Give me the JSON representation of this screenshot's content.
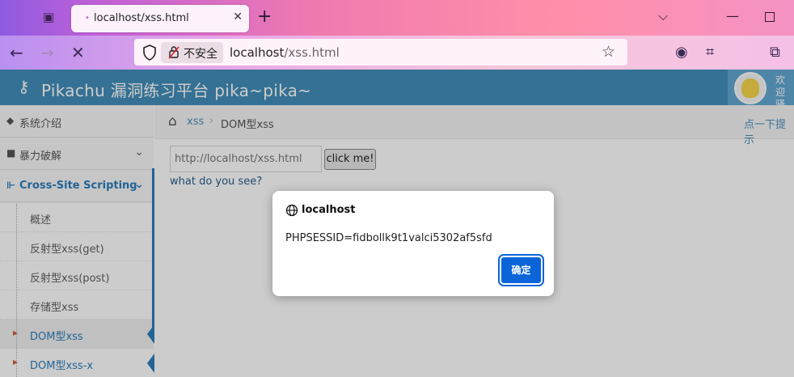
{
  "browser": {
    "tab_title": "localhost/xss.html",
    "tab_close": "✕",
    "new_tab": "+",
    "insecure_label": "不安全",
    "url_host": "localhost",
    "url_path": "/xss.html"
  },
  "header": {
    "site_title": "Pikachu 漏洞练习平台 pika~pika~",
    "user_line1": "欢迎",
    "user_line2": "骚年"
  },
  "sidebar": {
    "items": [
      {
        "label": "系统介绍"
      },
      {
        "label": "暴力破解"
      },
      {
        "label": "Cross-Site Scripting"
      }
    ],
    "sub_items": [
      {
        "label": "概述"
      },
      {
        "label": "反射型xss(get)"
      },
      {
        "label": "反射型xss(post)"
      },
      {
        "label": "存储型xss"
      },
      {
        "label": "DOM型xss"
      },
      {
        "label": "DOM型xss-x"
      }
    ]
  },
  "breadcrumb": {
    "parent": "xss",
    "separator": "›",
    "current": "DOM型xss",
    "hint": "点一下提示"
  },
  "content": {
    "input_placeholder": "http://localhost/xss.html",
    "button_label": "click me!",
    "link_text": "what do you see?"
  },
  "dialog": {
    "title": "localhost",
    "message": "PHPSESSID=fidbollk9t1valci5302af5sfd",
    "ok_label": "确定"
  },
  "colors": {
    "header_bg": "#438eb9",
    "accent": "#2b7dbc",
    "dialog_button": "#0b65d9"
  }
}
